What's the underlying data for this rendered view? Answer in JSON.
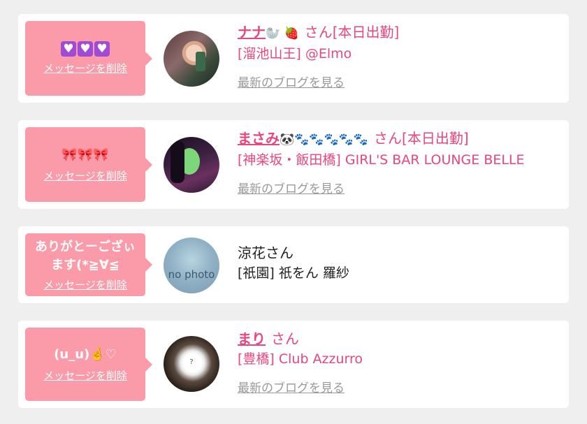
{
  "cards": [
    {
      "message_hearts": "♥♥♥",
      "delete_label": "メッセージを削除",
      "name": "ナナ",
      "name_deco": "🦭 🍓",
      "san": "さん[本日出勤]",
      "shop": "[溜池山王] @Elmo",
      "blog": "最新のブログを見る"
    },
    {
      "message": "🎀🎀🎀",
      "delete_label": "メッセージを削除",
      "name": "まさみ",
      "name_deco": "🐼🐾🐾🐾🐾🐾",
      "san": "さん[本日出勤]",
      "shop": "[神楽坂・飯田橋] GIRL'S BAR LOUNGE BELLE",
      "blog": "最新のブログを見る"
    },
    {
      "message": "ありがとーござぃ\nます(*≧∀≦",
      "delete_label": "メッセージを削除",
      "name": "涼花さん",
      "shop": "[祇園] 祇をん 羅紗",
      "avatar_text": "no photo"
    },
    {
      "message": "(u_u)🤞♡",
      "delete_label": "メッセージを削除",
      "name": "まり",
      "san": "さん",
      "shop": "[豊橋] Club Azzurro",
      "blog": "最新のブログを見る"
    }
  ],
  "colors": {
    "accent": "#e8467c",
    "bubble": "#fb9aa9",
    "background": "#efefef"
  }
}
